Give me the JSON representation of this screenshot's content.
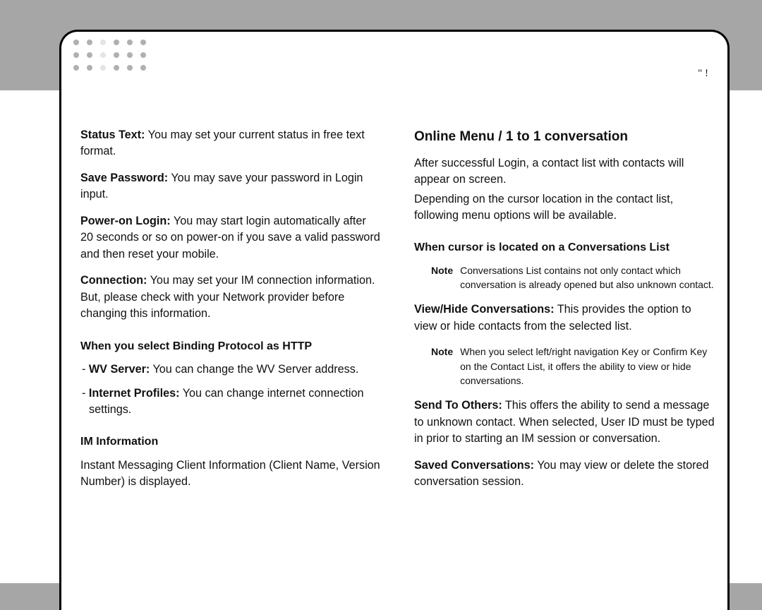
{
  "header": {
    "page_number": "\"   !",
    "dot_colors": [
      "#b0b0b0",
      "#b0b0b0",
      "#e4e4e4",
      "#b0b0b0",
      "#b0b0b0",
      "#b0b0b0",
      "#b0b0b0",
      "#b0b0b0",
      "#e4e4e4",
      "#b0b0b0",
      "#b0b0b0",
      "#b0b0b0",
      "#b0b0b0",
      "#b0b0b0",
      "#e4e4e4",
      "#b0b0b0",
      "#b0b0b0",
      "#b0b0b0"
    ]
  },
  "left": {
    "status_text_label": "Status Text:",
    "status_text_body": " You may set your current status in free text format.",
    "save_password_label": "Save Password:",
    "save_password_body": " You may save your password in Login input.",
    "power_on_label": "Power-on Login:",
    "power_on_body": " You may start login automatically after 20 seconds or so on power-on if you save a valid password and then reset your mobile.",
    "connection_label": "Connection:",
    "connection_body": " You may set your IM connection information. But, please check with your Network provider before changing this information.",
    "binding_heading": "When you select Binding Protocol as HTTP",
    "wv_label": "WV Server:",
    "wv_body": " You can change the WV Server address.",
    "profiles_label": "Internet Profiles:",
    "profiles_body": " You can change internet connection settings.",
    "im_heading": "IM Information",
    "im_body": "Instant Messaging Client Information (Client Name, Version Number) is displayed."
  },
  "right": {
    "title": "Online Menu / 1 to 1 conversation",
    "intro1": "After successful Login, a contact list with contacts will appear on screen.",
    "intro2": "Depending on the cursor location in the contact list, following menu options will be available.",
    "cursor_heading": "When cursor is located on a Conversations List",
    "note_label": "Note",
    "note1": "Conversations List contains not only contact which conversation is already opened but also unknown contact.",
    "viewhide_label": "View/Hide Conversations:",
    "viewhide_body": " This provides the option to view or hide contacts from the selected list.",
    "note2": "When you select left/right navigation Key or Confirm Key on the Contact List, it offers the ability to view or hide conversations.",
    "send_label": "Send To Others:",
    "send_body": " This offers the ability to send a message to unknown contact. When selected, User ID must be typed in prior to starting an IM session or conversation.",
    "saved_label": "Saved Conversations:",
    "saved_body": " You may view or delete the stored conversation session."
  }
}
